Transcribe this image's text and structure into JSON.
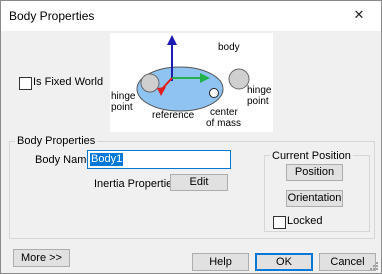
{
  "window": {
    "title": "Body Properties",
    "close_glyph": "✕"
  },
  "fixed_world": {
    "label": "Is Fixed World",
    "checked": false
  },
  "diagram": {
    "body": "body",
    "hinge_left_line1": "hinge",
    "hinge_left_line2": "point",
    "hinge_right_line1": "hinge",
    "hinge_right_line2": "point",
    "reference": "reference",
    "center_line1": "center",
    "center_line2": "of mass",
    "colors": {
      "body_fill": "#8fc4f2",
      "hinge_fill": "#cfcfcf",
      "x_axis": "#22b14c",
      "y_axis": "#1c1cb4",
      "z_axis": "#e01c1c"
    }
  },
  "body_properties": {
    "group_title": "Body Properties",
    "body_name_label": "Body Name:",
    "body_name_value": "Body1",
    "inertia_label": "Inertia Properties:",
    "edit_label": "Edit"
  },
  "current_position": {
    "group_title": "Current Position",
    "position_label": "Position",
    "orientation_label": "Orientation",
    "locked_label": "Locked",
    "locked_checked": false
  },
  "footer": {
    "more_label": "More >>",
    "help_label": "Help",
    "ok_label": "OK",
    "cancel_label": "Cancel"
  }
}
